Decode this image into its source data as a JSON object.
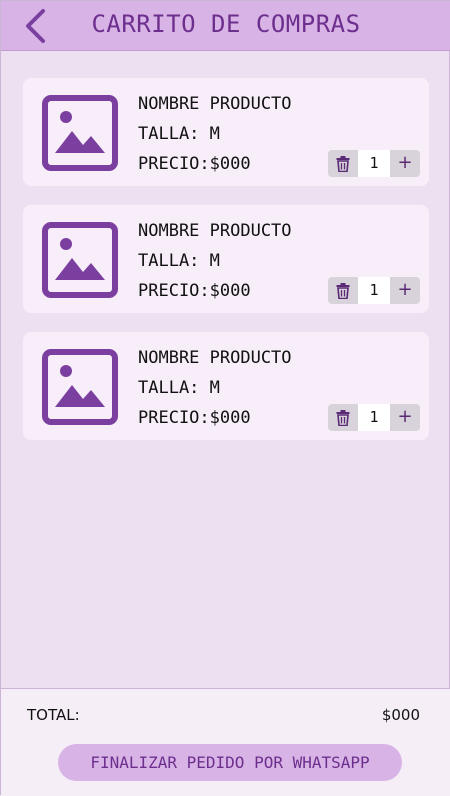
{
  "header": {
    "title": "CARRITO DE COMPRAS",
    "back_icon": "chevron-left-icon"
  },
  "cart": {
    "items": [
      {
        "name": "NOMBRE PRODUCTO",
        "size": "TALLA: M",
        "price": "PRECIO:$000",
        "quantity": "1",
        "image_icon": "image-placeholder-icon",
        "delete_icon": "trash-icon",
        "plus_label": "+"
      },
      {
        "name": "NOMBRE PRODUCTO",
        "size": "TALLA: M",
        "price": "PRECIO:$000",
        "quantity": "1",
        "image_icon": "image-placeholder-icon",
        "delete_icon": "trash-icon",
        "plus_label": "+"
      },
      {
        "name": "NOMBRE PRODUCTO",
        "size": "TALLA: M",
        "price": "PRECIO:$000",
        "quantity": "1",
        "image_icon": "image-placeholder-icon",
        "delete_icon": "trash-icon",
        "plus_label": "+"
      }
    ]
  },
  "footer": {
    "total_label": "TOTAL:",
    "total_value": "$000",
    "checkout_label": "FINALIZAR PEDIDO POR WHATSAPP"
  },
  "colors": {
    "header_bg": "#d8b3e6",
    "accent": "#6d2f8e",
    "icon_purple": "#7b3fa0",
    "page_bg": "#ede1f1",
    "card_bg": "#f7eef9"
  }
}
